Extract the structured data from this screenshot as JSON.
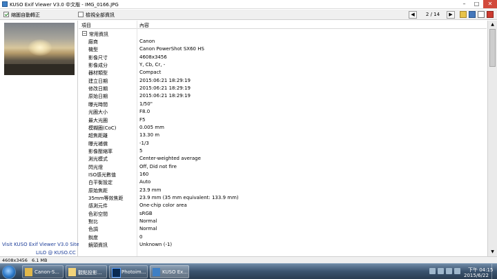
{
  "window": {
    "title": "KUSO Exif Viewer V3.0 中文版 - IMG_0166.JPG",
    "controls": [
      "–",
      "□",
      "✕"
    ]
  },
  "toolbar": {
    "auto_rotate_label": "縮圖自動轉正",
    "auto_rotate_checked": true,
    "show_all_label": "檢視全部資訊",
    "show_all_checked": false,
    "prev": "◀",
    "next": "▶",
    "page": "2 / 14"
  },
  "left_panel": {
    "site_text": "Visit KUSO Exif Viewer V3.0 Site",
    "credit_text": "LILO @ KUSO.CC"
  },
  "table": {
    "headers": [
      "項目",
      "內容"
    ],
    "group": "常用資訊",
    "rows": [
      {
        "label": "廠商",
        "value": "Canon"
      },
      {
        "label": "機型",
        "value": "Canon PowerShot SX60 HS"
      },
      {
        "label": "影像尺寸",
        "value": "4608x3456"
      },
      {
        "label": "影像成分",
        "value": "Y, Cb, Cr, -"
      },
      {
        "label": "器材類型",
        "value": "Compact"
      },
      {
        "label": "建立日期",
        "value": "2015:06:21 18:29:19"
      },
      {
        "label": "修改日期",
        "value": "2015:06:21 18:29:19"
      },
      {
        "label": "原始日期",
        "value": "2015:06:21 18:29:19"
      },
      {
        "label": "曝光時間",
        "value": "1/50\""
      },
      {
        "label": "光圈大小",
        "value": "F8.0"
      },
      {
        "label": "最大光圈",
        "value": "F5"
      },
      {
        "label": "模糊圈(CoC)",
        "value": "0.005 mm"
      },
      {
        "label": "超焦距離",
        "value": "13.30 m"
      },
      {
        "label": "曝光補償",
        "value": "-1/3"
      },
      {
        "label": "影像壓縮率",
        "value": "5"
      },
      {
        "label": "測光模式",
        "value": "Center-weighted average"
      },
      {
        "label": "閃光燈",
        "value": "Off, Did not fire"
      },
      {
        "label": "ISO感光數值",
        "value": "160"
      },
      {
        "label": "白平衡設定",
        "value": "Auto"
      },
      {
        "label": "原始焦距",
        "value": "23.9 mm"
      },
      {
        "label": "35mm等效焦距",
        "value": "23.9 mm (35 mm equivalent: 133.9 mm)"
      },
      {
        "label": "感測元件",
        "value": "One-chip color area"
      },
      {
        "label": "色彩空間",
        "value": "sRGB"
      },
      {
        "label": "對比",
        "value": "Normal"
      },
      {
        "label": "色調",
        "value": "Normal"
      },
      {
        "label": "銳度",
        "value": "0"
      },
      {
        "label": "鏡頭資訊",
        "value": "Unknown (-1)"
      }
    ]
  },
  "status": {
    "resolution": "4608x3456",
    "size": "6.1 MB"
  },
  "taskbar": {
    "tasks": [
      {
        "label": "Canon-S...",
        "icon": "folder-icon"
      },
      {
        "label": "觀點投影...",
        "icon": "viewer-icon"
      },
      {
        "label": "Photoim...",
        "icon": "photoshop-icon"
      },
      {
        "label": "KUSO Ex...",
        "icon": "kuso-exif-icon"
      }
    ],
    "time": "下午 04:15",
    "date": "2015/6/22"
  },
  "colors": {
    "link": "#1c3d99",
    "close_button": "#d24a3c",
    "taskbar": "#3a536e"
  }
}
